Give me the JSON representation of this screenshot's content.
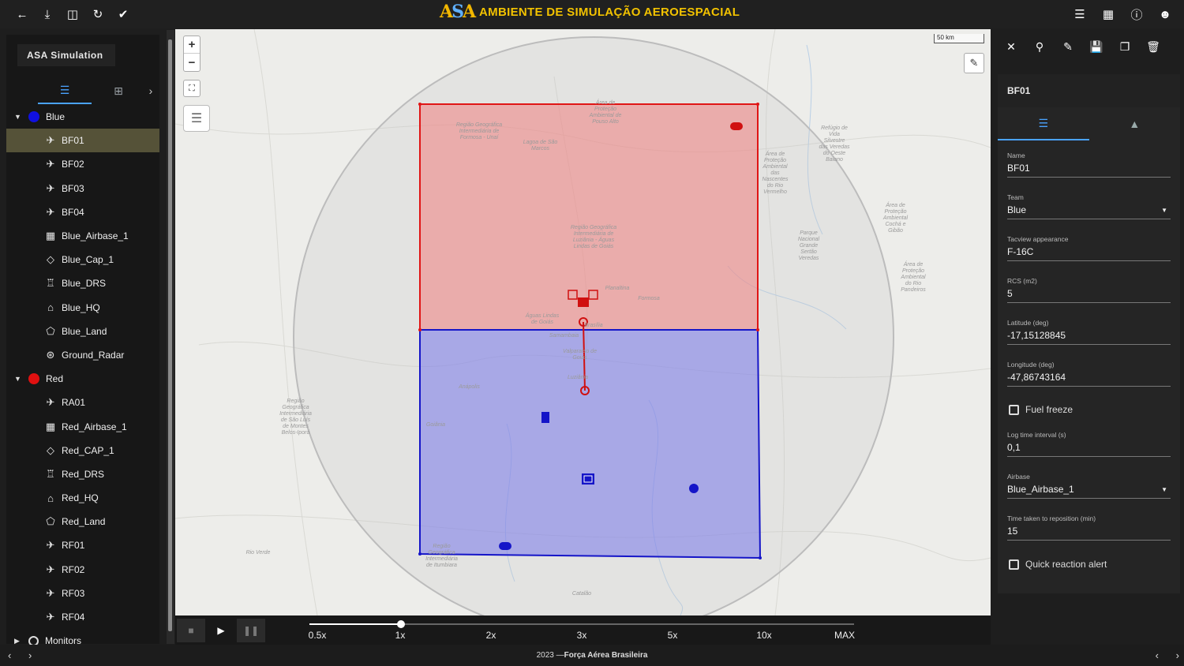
{
  "brand": {
    "logo_a": "A",
    "logo_s": "S",
    "logo_a2": "A",
    "title": "AMBIENTE DE SIMULAÇÃO AEROESPACIAL"
  },
  "topbar": {
    "left_icons": [
      "arrow-left-icon",
      "download-icon",
      "database-sync-icon",
      "world-refresh-icon",
      "check-icon"
    ],
    "right_icons": [
      "list-icon",
      "table-icon",
      "help-icon",
      "account-icon"
    ]
  },
  "sidebar": {
    "title": "ASA Simulation",
    "tabs": [
      "tree-icon",
      "add-entity-icon"
    ],
    "groups": [
      {
        "label": "Blue",
        "color": "#1010e0",
        "items": [
          {
            "label": "BF01",
            "icon": "aircraft-icon",
            "selected": true
          },
          {
            "label": "BF02",
            "icon": "aircraft-icon"
          },
          {
            "label": "BF03",
            "icon": "aircraft-icon"
          },
          {
            "label": "BF04",
            "icon": "aircraft-icon"
          },
          {
            "label": "Blue_Airbase_1",
            "icon": "airbase-icon"
          },
          {
            "label": "Blue_Cap_1",
            "icon": "cap-icon"
          },
          {
            "label": "Blue_DRS",
            "icon": "drs-icon"
          },
          {
            "label": "Blue_HQ",
            "icon": "hq-icon"
          },
          {
            "label": "Blue_Land",
            "icon": "land-icon"
          },
          {
            "label": "Ground_Radar",
            "icon": "radar-icon"
          }
        ]
      },
      {
        "label": "Red",
        "color": "#e01010",
        "items": [
          {
            "label": "RA01",
            "icon": "aircraft-icon"
          },
          {
            "label": "Red_Airbase_1",
            "icon": "airbase-icon"
          },
          {
            "label": "Red_CAP_1",
            "icon": "cap-icon"
          },
          {
            "label": "Red_DRS",
            "icon": "drs-icon"
          },
          {
            "label": "Red_HQ",
            "icon": "hq-icon"
          },
          {
            "label": "Red_Land",
            "icon": "land-icon"
          },
          {
            "label": "RF01",
            "icon": "aircraft-icon"
          },
          {
            "label": "RF02",
            "icon": "aircraft-icon"
          },
          {
            "label": "RF03",
            "icon": "aircraft-icon"
          },
          {
            "label": "RF04",
            "icon": "aircraft-icon"
          }
        ]
      }
    ],
    "monitors": "Monitors"
  },
  "map": {
    "scale": "50 km",
    "zoom_in": "+",
    "zoom_out": "−",
    "labels": [
      {
        "text": "Região Geográfica Intermediária de Formosa - Unaí"
      },
      {
        "text": "Lagoa de São Marcos"
      },
      {
        "text": "Área de Proteção Ambiental de Pouso Alto"
      },
      {
        "text": "Refúgio de Vida Silvestre das Veredas do Oeste Baiano"
      },
      {
        "text": "Área de Proteção Ambiental das Nascentes do Rio Vermelho"
      },
      {
        "text": "Região Geográfica Intermediária de Luziânia - Águas Lindas de Goiás"
      },
      {
        "text": "Parque Nacional Grande Sertão Veredas"
      },
      {
        "text": "Área de Proteção Ambiental do Rio Pandeiros"
      },
      {
        "text": "Planaltina"
      },
      {
        "text": "Formosa"
      },
      {
        "text": "Águas Lindas de Goiás"
      },
      {
        "text": "Brasília"
      },
      {
        "text": "Samambaia"
      },
      {
        "text": "Valparaíso de Goiás"
      },
      {
        "text": "Luziânia"
      },
      {
        "text": "Anápolis"
      },
      {
        "text": "Goiânia"
      },
      {
        "text": "Região Geográfica Intermediária de São Luís de Montes Belos-Iporá"
      },
      {
        "text": "Rio Verde"
      },
      {
        "text": "Região Geográfica Intermediária de Itumbiara"
      },
      {
        "text": "Catalão"
      },
      {
        "text": "Área de Proteção Ambiental Cochá e Gibão"
      }
    ],
    "zones": [
      {
        "name": "red-zone",
        "fill": "#f08080",
        "stroke": "#e01515"
      },
      {
        "name": "blue-zone",
        "fill": "#8080f0",
        "stroke": "#1515c8"
      }
    ]
  },
  "playback": {
    "speeds": [
      "0.5x",
      "1x",
      "2x",
      "3x",
      "5x",
      "10x",
      "MAX"
    ],
    "selected_speed": "1x",
    "buttons": [
      "stop-icon",
      "play-icon",
      "pause-icon"
    ]
  },
  "footer": {
    "year": "2023 — ",
    "org": "Força Aérea Brasileira"
  },
  "details": {
    "toolbar": [
      "close-icon",
      "search-doc-icon",
      "edit-icon",
      "save-icon",
      "copy-icon",
      "delete-icon"
    ],
    "header": "BF01",
    "tabs": [
      "properties-icon",
      "hierarchy-icon"
    ],
    "fields": [
      {
        "label": "Name",
        "value": "BF01",
        "dropdown": false
      },
      {
        "label": "Team",
        "value": "Blue",
        "dropdown": true
      },
      {
        "label": "Tacview appearance",
        "value": "F-16C",
        "dropdown": false
      },
      {
        "label": "RCS (m2)",
        "value": "5",
        "dropdown": false
      },
      {
        "label": "Latitude (deg)",
        "value": "-17,15128845",
        "dropdown": false
      },
      {
        "label": "Longitude (deg)",
        "value": "-47,86743164",
        "dropdown": false
      }
    ],
    "fuel_freeze": "Fuel freeze",
    "fields2": [
      {
        "label": "Log time interval (s)",
        "value": "0,1",
        "dropdown": false
      },
      {
        "label": "Airbase",
        "value": "Blue_Airbase_1",
        "dropdown": true
      },
      {
        "label": "Time taken to reposition (min)",
        "value": "15",
        "dropdown": false
      }
    ],
    "quick_reaction": "Quick reaction alert"
  }
}
